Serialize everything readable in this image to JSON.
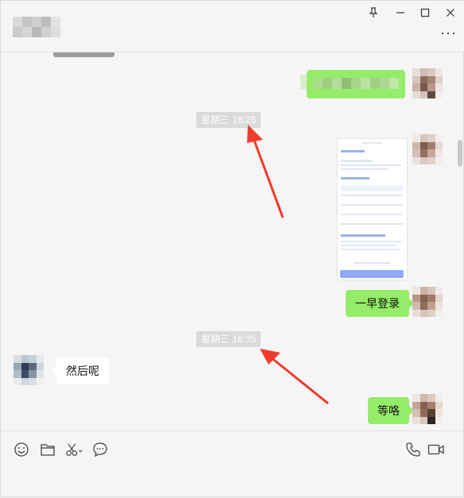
{
  "window": {
    "controls": [
      "pin-icon",
      "minimize-icon",
      "maximize-icon",
      "close-icon"
    ],
    "more_label": "···"
  },
  "messages": {
    "time1": "星期三 16:25",
    "msg_login": "一早登录",
    "time2": "星期三 16:35",
    "msg_then": "然后呢",
    "msg_wait": "等咯"
  },
  "toolbar": {
    "icons": [
      "emoji-icon",
      "folder-icon",
      "scissors-icon",
      "chat-bubble-icon",
      "phone-icon",
      "video-icon"
    ]
  },
  "colors": {
    "my_bubble": "#95ec69",
    "other_bubble": "#ffffff",
    "time_badge": "#dadada",
    "annotation_arrow": "#ee3b2b",
    "background": "#f5f5f5"
  }
}
